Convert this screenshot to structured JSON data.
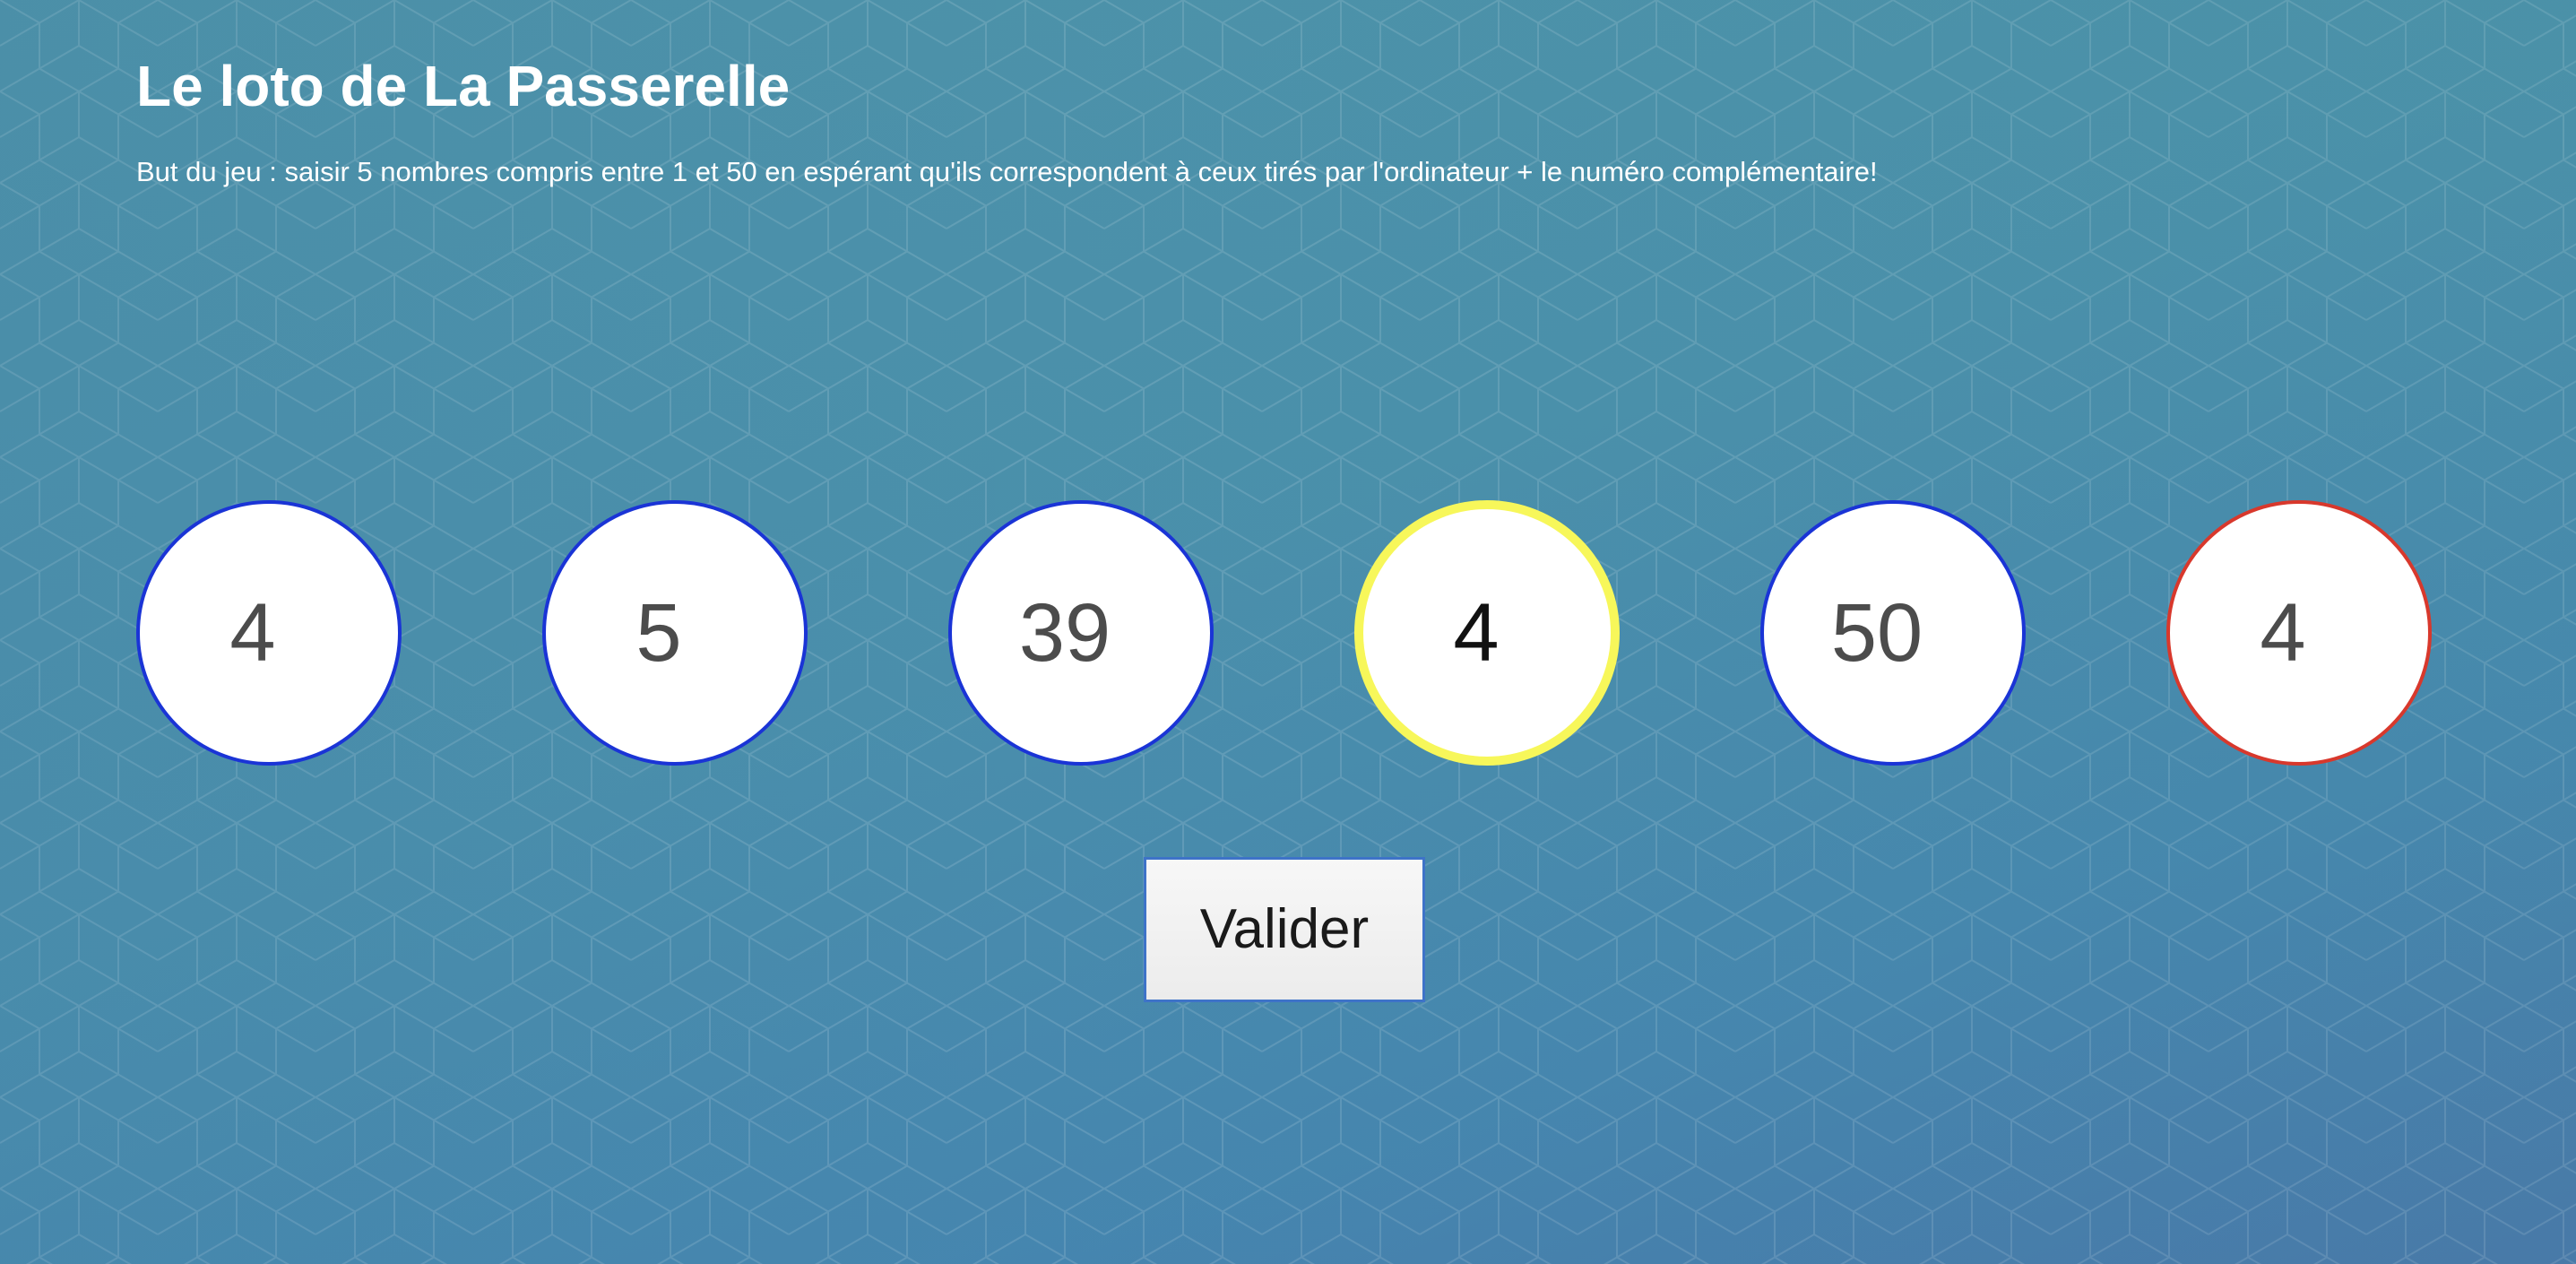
{
  "page": {
    "title": "Le loto de La Passerelle",
    "subtitle": "But du jeu : saisir 5 nombres compris entre 1 et 50 en espérant qu'ils correspondent à ceux tirés par l'ordinateur + le numéro complémentaire!"
  },
  "balls": [
    {
      "value": "4",
      "state": "normal"
    },
    {
      "value": "5",
      "state": "normal"
    },
    {
      "value": "39",
      "state": "normal"
    },
    {
      "value": "4",
      "state": "focused"
    },
    {
      "value": "50",
      "state": "normal"
    },
    {
      "value": "4",
      "state": "complementary"
    }
  ],
  "actions": {
    "submit_label": "Valider"
  },
  "colors": {
    "ball_border": "#1a34d6",
    "focus_ring": "#f7f75a",
    "complementary_border": "#d8382c",
    "button_border": "#3e73c8",
    "text_white": "#ffffff"
  }
}
